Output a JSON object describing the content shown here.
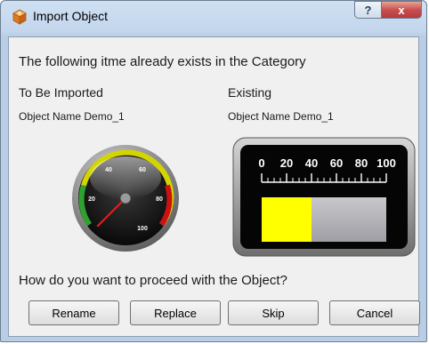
{
  "window": {
    "title": "Import Object",
    "help_glyph": "?",
    "close_glyph": "x"
  },
  "message": "The following itme already exists in the Category",
  "to_be_imported": {
    "heading": "To Be Imported",
    "object_name": "Object Name Demo_1",
    "gauge": {
      "type": "dial",
      "ticks": [
        "20",
        "40",
        "60",
        "80",
        "100"
      ],
      "value": 5,
      "min": 0,
      "max": 100
    }
  },
  "existing": {
    "heading": "Existing",
    "object_name": "Object Name Demo_1",
    "gauge": {
      "type": "bar",
      "ticks": [
        "0",
        "20",
        "40",
        "60",
        "80",
        "100"
      ],
      "value": 40,
      "min": 0,
      "max": 100,
      "fill_color": "#ffff00"
    }
  },
  "question": "How do you want to proceed with the Object?",
  "buttons": {
    "rename": "Rename",
    "replace": "Replace",
    "skip": "Skip",
    "cancel": "Cancel"
  },
  "icons": {
    "app": "app-cube-icon",
    "help": "help-icon",
    "close": "close-icon"
  }
}
